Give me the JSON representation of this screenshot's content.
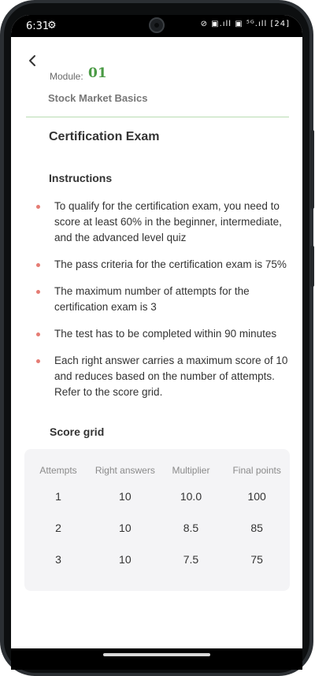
{
  "status_bar": {
    "time": "6:31",
    "indicators": "⊘ ▣.ıll ▣ ⁵ᴳ.ıll [24]"
  },
  "header": {
    "back_icon": "chevron-left-icon",
    "module_label": "Module:",
    "module_number": "01",
    "module_name": "Stock Market Basics"
  },
  "exam": {
    "title": "Certification Exam",
    "instructions_title": "Instructions",
    "instructions": [
      "To qualify for the certification exam, you need to score at least 60% in the beginner, intermediate, and the advanced level quiz",
      "The pass criteria for the certification exam is 75%",
      "The maximum number of attempts for the certification exam is 3",
      "The test has to be completed within 90 minutes",
      "Each right answer carries a maximum score of 10 and reduces based on the number of attempts. Refer to the score grid."
    ]
  },
  "score_grid": {
    "title": "Score grid",
    "columns": [
      "Attempts",
      "Right answers",
      "Multiplier",
      "Final points"
    ],
    "rows": [
      [
        "1",
        "10",
        "10.0",
        "100"
      ],
      [
        "2",
        "10",
        "8.5",
        "85"
      ],
      [
        "3",
        "10",
        "7.5",
        "75"
      ]
    ]
  },
  "colors": {
    "accent_green": "#4a9a44",
    "bullet_red": "#e57c74",
    "divider_green": "#b9dcb3"
  }
}
